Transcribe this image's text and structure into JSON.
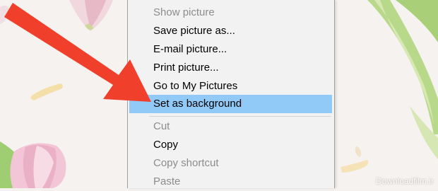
{
  "context_menu": {
    "items": [
      {
        "label": "Show picture",
        "state": "disabled"
      },
      {
        "label": "Save picture as...",
        "state": "enabled"
      },
      {
        "label": "E-mail picture...",
        "state": "enabled"
      },
      {
        "label": "Print picture...",
        "state": "enabled"
      },
      {
        "label": "Go to My Pictures",
        "state": "enabled"
      },
      {
        "label": "Set as background",
        "state": "highlighted"
      },
      {
        "label": "Cut",
        "state": "disabled"
      },
      {
        "label": "Copy",
        "state": "enabled"
      },
      {
        "label": "Copy shortcut",
        "state": "disabled"
      },
      {
        "label": "Paste",
        "state": "disabled"
      }
    ]
  },
  "watermark": {
    "text": "Downloadfilm.ir"
  },
  "colors": {
    "highlight": "#91c9f7",
    "arrow": "#f0402c",
    "menu_background": "#f2f2f2",
    "disabled_text": "#8c8c8c"
  }
}
